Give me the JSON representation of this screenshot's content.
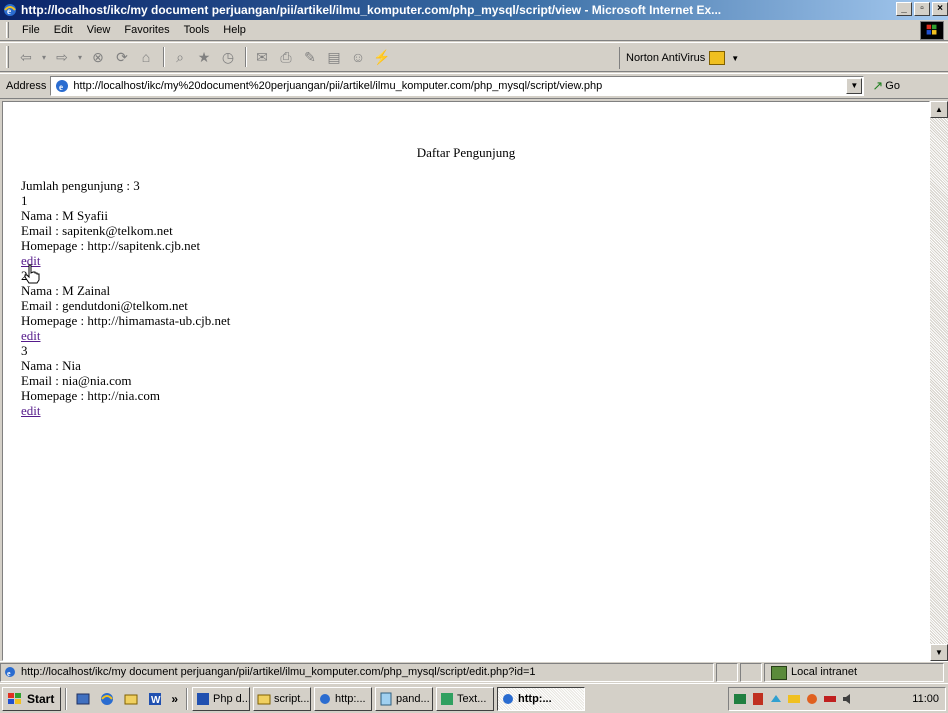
{
  "window": {
    "title": "http://localhost/ikc/my document perjuangan/pii/artikel/ilmu_komputer.com/php_mysql/script/view - Microsoft Internet Ex..."
  },
  "menu": {
    "items": [
      "File",
      "Edit",
      "View",
      "Favorites",
      "Tools",
      "Help"
    ]
  },
  "toolbar": {
    "norton_label": "Norton AntiVirus"
  },
  "address": {
    "label": "Address",
    "url": "http://localhost/ikc/my%20document%20perjuangan/pii/artikel/ilmu_komputer.com/php_mysql/script/view.php",
    "go_label": "Go"
  },
  "page": {
    "heading": "Daftar Pengunjung",
    "count_line": "Jumlah pengunjung : 3",
    "visitors": [
      {
        "number": "1",
        "nama": "Nama : M Syafii",
        "email": "Email : sapitenk@telkom.net",
        "homepage": "Homepage : http://sapitenk.cjb.net",
        "edit": "edit"
      },
      {
        "number": "2",
        "nama": "Nama : M Zainal",
        "email": "Email : gendutdoni@telkom.net",
        "homepage": "Homepage : http://himamasta-ub.cjb.net",
        "edit": "edit"
      },
      {
        "number": "3",
        "nama": "Nama : Nia",
        "email": "Email : nia@nia.com",
        "homepage": "Homepage : http://nia.com",
        "edit": "edit"
      }
    ]
  },
  "status": {
    "text": "http://localhost/ikc/my document perjuangan/pii/artikel/ilmu_komputer.com/php_mysql/script/edit.php?id=1",
    "zone": "Local intranet"
  },
  "taskbar": {
    "start_label": "Start",
    "more": "»",
    "tasks": [
      "Php d...",
      "script...",
      "http:...",
      "pand...",
      "Text...",
      "http:..."
    ],
    "clock": "11:00"
  },
  "colors": {
    "title_gradient_start": "#0a246a",
    "title_gradient_end": "#a6caf0",
    "visited_link": "#551a8b",
    "chrome": "#d4d0c8"
  },
  "icons": [
    "ie-icon",
    "back-icon",
    "forward-icon",
    "stop-icon",
    "refresh-icon",
    "home-icon",
    "search-icon",
    "favorites-icon",
    "history-icon",
    "mail-icon",
    "print-icon",
    "edit-icon",
    "discuss-icon",
    "messenger-icon",
    "norton-icon",
    "go-icon",
    "hand-cursor-icon",
    "local-intranet-icon",
    "start-flag-icon"
  ]
}
